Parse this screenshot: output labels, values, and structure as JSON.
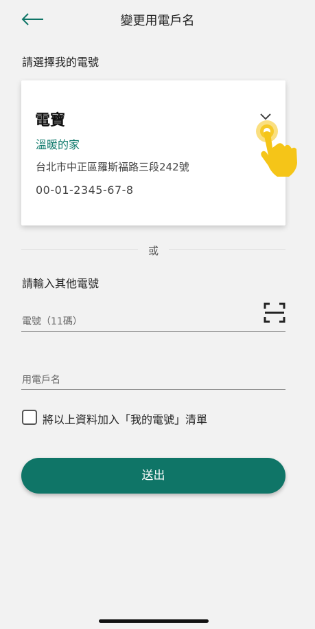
{
  "header": {
    "title": "變更用電戶名"
  },
  "my_meter": {
    "section_label": "請選擇我的電號",
    "card": {
      "name": "電寶",
      "nickname": "溫暖的家",
      "address": "台北市中正區羅斯福路三段242號",
      "account": "00-01-2345-67-8"
    }
  },
  "divider": {
    "or_label": "或"
  },
  "other_meter": {
    "section_label": "請輸入其他電號",
    "meter_placeholder": "電號（11碼）",
    "name_placeholder": "用電戶名"
  },
  "save_checkbox": {
    "label": "將以上資料加入「我的電號」清單",
    "checked": false
  },
  "submit": {
    "label": "送出"
  },
  "colors": {
    "accent": "#0f7567",
    "nickname": "#0f7a6c",
    "background": "#f2f2f2"
  },
  "icons": {
    "back": "arrow-left-icon",
    "dropdown": "chevron-down-icon",
    "scan": "scan-icon",
    "hint": "tap-hand-icon"
  }
}
